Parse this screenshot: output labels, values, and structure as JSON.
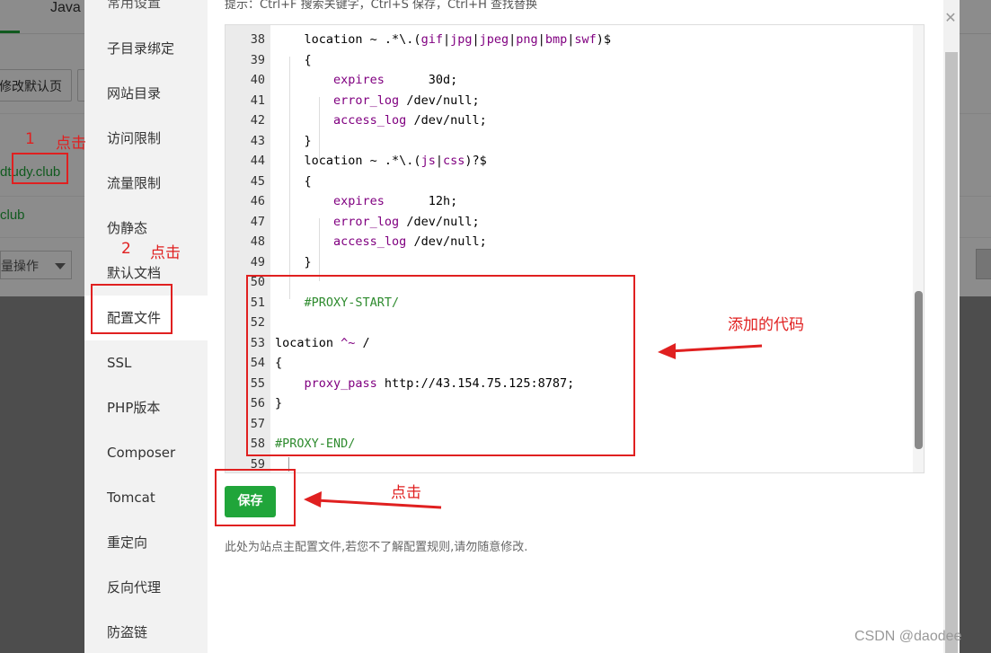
{
  "background": {
    "tab_label": "Java",
    "default_page_button": "修改默认页",
    "site_1": "dtudy.club",
    "site_2": "club",
    "batch_label": "量操作"
  },
  "modal": {
    "sidebar_top_partial": "常用设置",
    "sidebar": [
      "子目录绑定",
      "网站目录",
      "访问限制",
      "流量限制",
      "伪静态",
      "默认文档",
      "配置文件",
      "SSL",
      "PHP版本",
      "Composer",
      "Tomcat",
      "重定向",
      "反向代理",
      "防盗链"
    ],
    "active_item": "配置文件",
    "hint": "提示：Ctrl+F 搜索关键字，Ctrl+S 保存，Ctrl+H 查找替换",
    "editor": {
      "lines": [
        {
          "n": "38",
          "segs": [
            [
              "    location ~ .*\\.(",
              ""
            ],
            [
              "gif",
              "kw"
            ],
            [
              "|",
              ""
            ],
            [
              "jpg",
              "kw"
            ],
            [
              "|",
              ""
            ],
            [
              "jpeg",
              "kw"
            ],
            [
              "|",
              ""
            ],
            [
              "png",
              "kw"
            ],
            [
              "|",
              ""
            ],
            [
              "bmp",
              "kw"
            ],
            [
              "|",
              ""
            ],
            [
              "swf",
              "kw"
            ],
            [
              ")$",
              ""
            ]
          ]
        },
        {
          "n": "39",
          "segs": [
            [
              "    {",
              ""
            ]
          ]
        },
        {
          "n": "40",
          "segs": [
            [
              "        ",
              ""
            ],
            [
              "expires",
              "kw"
            ],
            [
              "      30d;",
              ""
            ]
          ]
        },
        {
          "n": "41",
          "segs": [
            [
              "        ",
              ""
            ],
            [
              "error_log",
              "kw"
            ],
            [
              " /dev/null;",
              ""
            ]
          ]
        },
        {
          "n": "42",
          "segs": [
            [
              "        ",
              ""
            ],
            [
              "access_log",
              "kw"
            ],
            [
              " /dev/null;",
              ""
            ]
          ]
        },
        {
          "n": "43",
          "segs": [
            [
              "    }",
              ""
            ]
          ]
        },
        {
          "n": "44",
          "segs": [
            [
              "    location ~ .*\\.(",
              ""
            ],
            [
              "js",
              "kw"
            ],
            [
              "|",
              ""
            ],
            [
              "css",
              "kw"
            ],
            [
              ")?$",
              ""
            ]
          ]
        },
        {
          "n": "45",
          "segs": [
            [
              "    {",
              ""
            ]
          ]
        },
        {
          "n": "46",
          "segs": [
            [
              "        ",
              ""
            ],
            [
              "expires",
              "kw"
            ],
            [
              "      12h;",
              ""
            ]
          ]
        },
        {
          "n": "47",
          "segs": [
            [
              "        ",
              ""
            ],
            [
              "error_log",
              "kw"
            ],
            [
              " /dev/null;",
              ""
            ]
          ]
        },
        {
          "n": "48",
          "segs": [
            [
              "        ",
              ""
            ],
            [
              "access_log",
              "kw"
            ],
            [
              " /dev/null;",
              ""
            ]
          ]
        },
        {
          "n": "49",
          "segs": [
            [
              "    }",
              ""
            ]
          ]
        },
        {
          "n": "50",
          "segs": [
            [
              "",
              ""
            ]
          ]
        },
        {
          "n": "51",
          "segs": [
            [
              "    ",
              ""
            ],
            [
              "#PROXY-START/",
              "cm"
            ]
          ]
        },
        {
          "n": "52",
          "segs": [
            [
              "",
              ""
            ]
          ]
        },
        {
          "n": "53",
          "segs": [
            [
              "location ",
              ""
            ],
            [
              "^~",
              "kw"
            ],
            [
              " /",
              ""
            ]
          ]
        },
        {
          "n": "54",
          "segs": [
            [
              "{",
              ""
            ]
          ]
        },
        {
          "n": "55",
          "segs": [
            [
              "    ",
              ""
            ],
            [
              "proxy_pass",
              "kw"
            ],
            [
              " http://43.154.75.125:8787;",
              ""
            ]
          ]
        },
        {
          "n": "56",
          "segs": [
            [
              "}",
              ""
            ]
          ]
        },
        {
          "n": "57",
          "segs": [
            [
              "",
              ""
            ]
          ]
        },
        {
          "n": "58",
          "segs": [
            [
              "",
              ""
            ],
            [
              "#PROXY-END/",
              "cm"
            ]
          ]
        },
        {
          "n": "59",
          "segs": [
            [
              "",
              ""
            ]
          ]
        }
      ]
    },
    "save_label": "保存",
    "note": "此处为站点主配置文件,若您不了解配置规则,请勿随意修改."
  },
  "annotations": {
    "step1_num": "1",
    "step1_text": "点击",
    "step2_num": "2",
    "step2_text": "点击",
    "added_code": "添加的代码",
    "click_save": "点击"
  },
  "watermark": "CSDN @daodee",
  "colors": {
    "accent": "#20a53a",
    "annotation": "#e02020",
    "keyword": "#800080",
    "comment": "#2e8b2e"
  }
}
